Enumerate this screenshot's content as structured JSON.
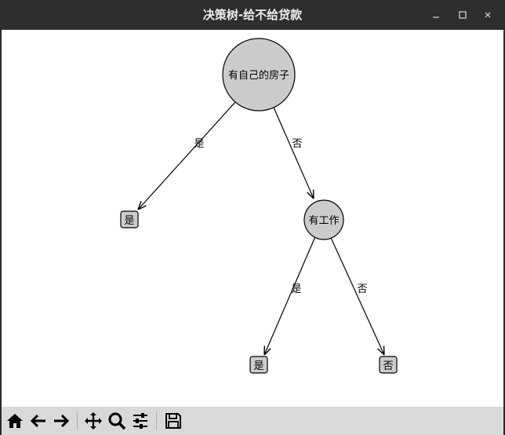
{
  "window": {
    "title": "决策树-给不给贷款",
    "minimize_icon": "minimize-icon",
    "maximize_icon": "maximize-icon",
    "close_icon": "close-icon"
  },
  "tree": {
    "root": {
      "label": "有自己的房子"
    },
    "root_edges": {
      "left_label": "是",
      "right_label": "否"
    },
    "leaf_left": {
      "label": "是"
    },
    "node_work": {
      "label": "有工作"
    },
    "work_edges": {
      "left_label": "是",
      "right_label": "否"
    },
    "leaf_work_yes": {
      "label": "是"
    },
    "leaf_work_no": {
      "label": "否"
    }
  },
  "colors": {
    "node_fill": "#cccccc",
    "stroke": "#000000",
    "toolbar_bg": "#d9d9d9",
    "titlebar_bg": "#2e2e2e"
  },
  "toolbar": {
    "buttons": [
      "home-icon",
      "back-icon",
      "forward-icon",
      "pan-icon",
      "zoom-icon",
      "configure-subplots-icon",
      "save-icon"
    ]
  }
}
